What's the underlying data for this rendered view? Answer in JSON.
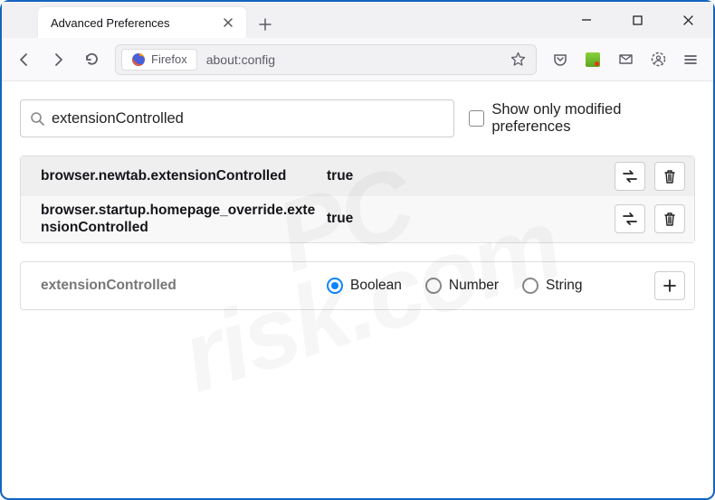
{
  "window": {
    "tab_title": "Advanced Preferences"
  },
  "urlbar": {
    "identity_label": "Firefox",
    "address": "about:config"
  },
  "search": {
    "value": "extensionControlled",
    "show_modified_label": "Show only modified preferences"
  },
  "prefs": [
    {
      "name": "browser.newtab.extensionControlled",
      "value": "true"
    },
    {
      "name": "browser.startup.homepage_override.extensionControlled",
      "value": "true"
    }
  ],
  "add_row": {
    "name": "extensionControlled",
    "types": {
      "boolean": "Boolean",
      "number": "Number",
      "string": "String",
      "selected": "boolean"
    }
  },
  "watermark": {
    "line1": "PC",
    "line2": "risk.com"
  }
}
